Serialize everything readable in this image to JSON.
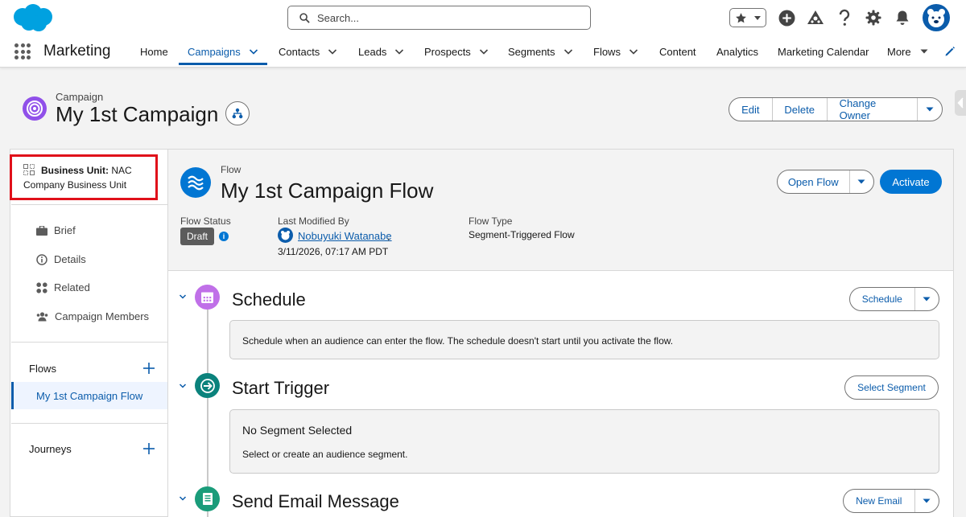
{
  "header": {
    "search_placeholder": "Search...",
    "colors": {
      "brand": "#00a1e0",
      "accent": "#0176d3",
      "alert": "#e0101a"
    }
  },
  "nav": {
    "app_name": "Marketing",
    "items": [
      {
        "label": "Home",
        "has_menu": false
      },
      {
        "label": "Campaigns",
        "has_menu": true,
        "active": true
      },
      {
        "label": "Contacts",
        "has_menu": true
      },
      {
        "label": "Leads",
        "has_menu": true
      },
      {
        "label": "Prospects",
        "has_menu": true
      },
      {
        "label": "Segments",
        "has_menu": true
      },
      {
        "label": "Flows",
        "has_menu": true
      },
      {
        "label": "Content",
        "has_menu": false
      },
      {
        "label": "Analytics",
        "has_menu": false
      },
      {
        "label": "Marketing Calendar",
        "has_menu": false
      },
      {
        "label": "More",
        "has_menu": true
      }
    ]
  },
  "record": {
    "object_label": "Campaign",
    "title": "My 1st Campaign",
    "actions": [
      "Edit",
      "Delete",
      "Change Owner"
    ]
  },
  "left": {
    "business_unit_label": "Business Unit:",
    "business_unit_value": "NAC",
    "business_unit_line2": "Company Business Unit",
    "items": [
      "Brief",
      "Details",
      "Related",
      "Campaign Members"
    ],
    "flows_label": "Flows",
    "selected_flow": "My 1st Campaign Flow",
    "journeys_label": "Journeys"
  },
  "flow": {
    "object_label": "Flow",
    "title": "My 1st Campaign Flow",
    "open_label": "Open Flow",
    "activate_label": "Activate",
    "status_label": "Flow Status",
    "status_value": "Draft",
    "info_glyph": "i",
    "modified_label": "Last Modified By",
    "modified_by": "Nobuyuki Watanabe",
    "modified_sep": ",",
    "modified_at": "3/11/2026, 07:17 AM PDT",
    "type_label": "Flow Type",
    "type_value": "Segment-Triggered Flow"
  },
  "steps": {
    "schedule": {
      "title": "Schedule",
      "button": "Schedule",
      "description": "Schedule when an audience can enter the flow. The schedule doesn't start until you activate the flow."
    },
    "trigger": {
      "title": "Start Trigger",
      "button": "Select Segment",
      "heading": "No Segment Selected",
      "description": "Select or create an audience segment."
    },
    "email": {
      "title": "Send Email Message",
      "button": "New Email"
    }
  }
}
